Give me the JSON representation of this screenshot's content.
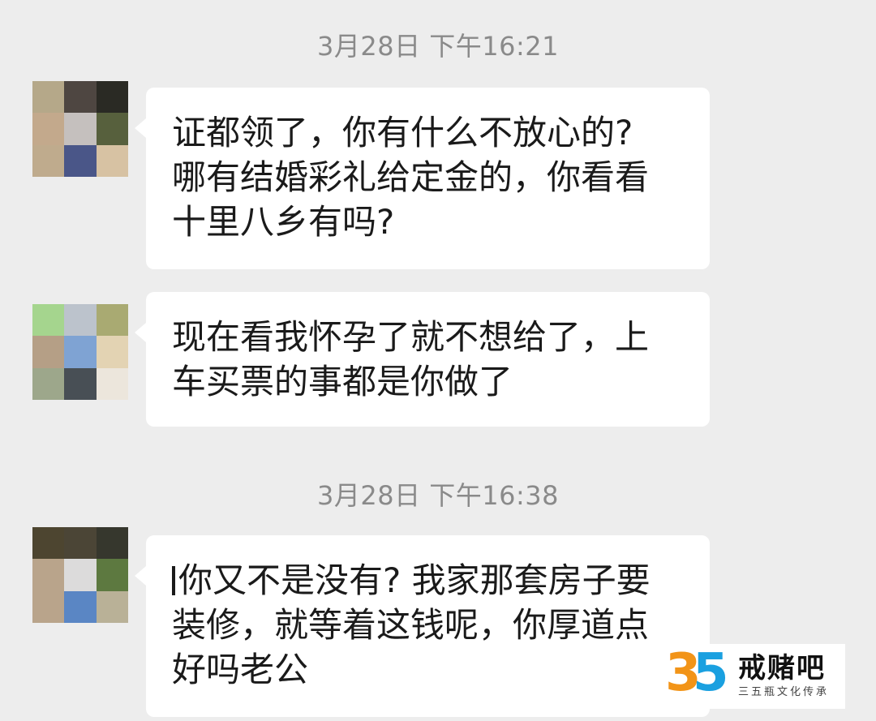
{
  "timestamps": [
    "3月28日 下午16:21",
    "3月28日 下午16:38"
  ],
  "messages": [
    {
      "lines": [
        "证都领了，你有什么不放心的?",
        "哪有结婚彩礼给定金的，你看看",
        "十里八乡有吗?"
      ],
      "avatar_colors": [
        "#b5a889",
        "#4e4641",
        "#2a2a24",
        "#c3a98c",
        "#c5c0be",
        "#57603d",
        "#bfab8d",
        "#4a5688",
        "#d7c2a3"
      ]
    },
    {
      "lines": [
        "现在看我怀孕了就不想给了，上",
        "车买票的事都是你做了"
      ],
      "avatar_colors": [
        "#a5d58e",
        "#bcc3cc",
        "#a9aa72",
        "#b59f86",
        "#7fa3d3",
        "#e3d3b3",
        "#9da78b",
        "#484f55",
        "#ece6dc"
      ]
    },
    {
      "lines": [
        "你又不是没有? 我家那套房子要",
        "装修，就等着这钱呢，你厚道点",
        "好吗老公"
      ],
      "avatar_colors": [
        "#4d4530",
        "#4b4536",
        "#36372d",
        "#b9a48b",
        "#dcdbdb",
        "#5d7940",
        "#b9a48b",
        "#5a86c4",
        "#b9b197"
      ]
    }
  ],
  "watermark": {
    "logo_digit_1": "3",
    "logo_digit_2": "5",
    "title": "戒赌吧",
    "subtitle": "三五瓶文化传承"
  }
}
